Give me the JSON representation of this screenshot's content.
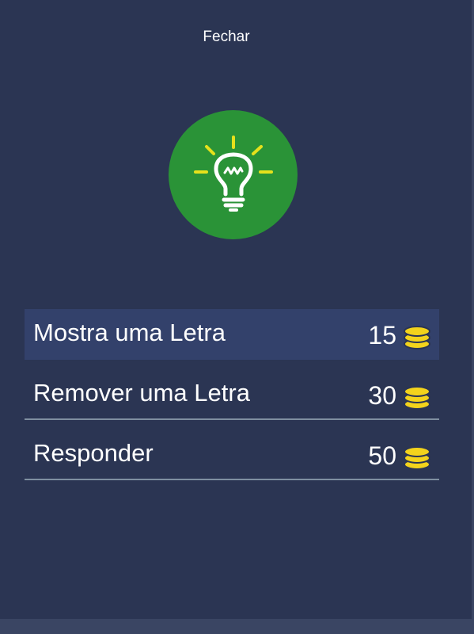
{
  "header": {
    "close_label": "Fechar"
  },
  "hero": {
    "icon": "lightbulb-icon",
    "circle_color": "#2a9337",
    "ray_color": "#e5e11c"
  },
  "options": [
    {
      "label": "Mostra uma Letra",
      "cost": "15",
      "icon": "coins-icon",
      "selected": true
    },
    {
      "label": "Remover uma Letra",
      "cost": "30",
      "icon": "coins-icon",
      "selected": false
    },
    {
      "label": "Responder",
      "cost": "50",
      "icon": "coins-icon",
      "selected": false
    }
  ],
  "colors": {
    "background": "#2b3553",
    "selected_row": "#33416b",
    "divider": "#7f8fa0",
    "coin": "#f3d31c"
  }
}
